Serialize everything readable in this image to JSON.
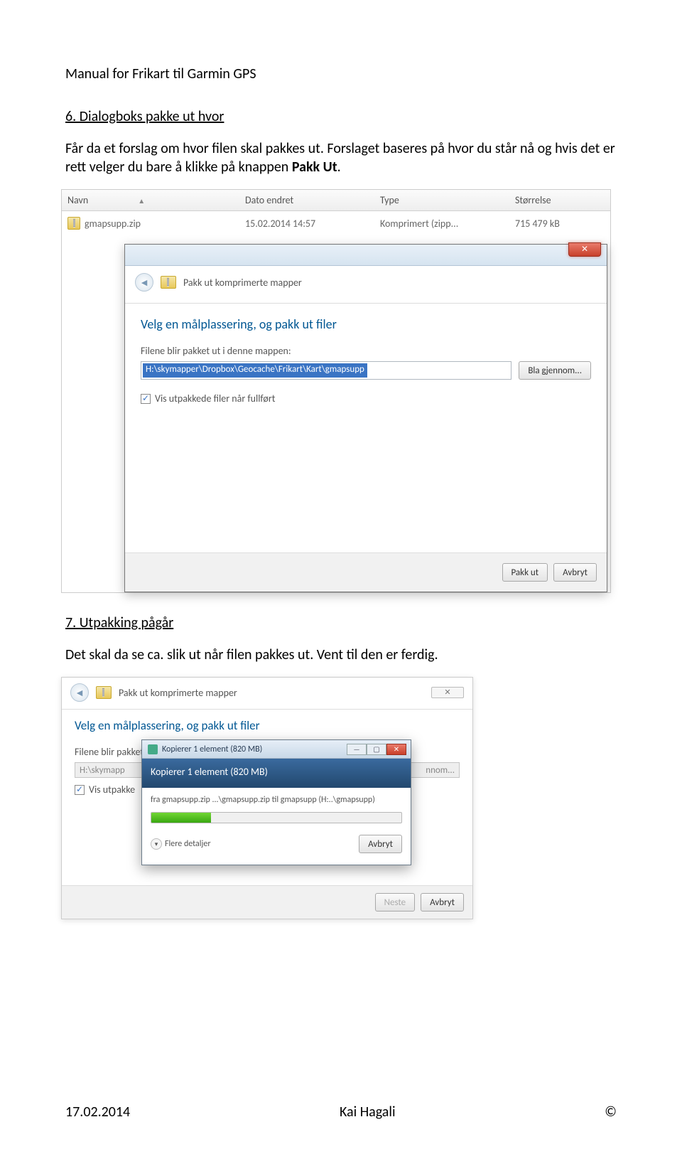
{
  "doc": {
    "title": "Manual for Frikart til Garmin GPS"
  },
  "sec6": {
    "heading": "6.   Dialogboks pakke ut hvor",
    "p1": "Får da et forslag om hvor filen skal pakkes ut. Forslaget baseres på hvor du står nå og hvis det er rett velger du bare å klikke på knappen ",
    "bold": "Pakk Ut",
    "tail": "."
  },
  "list": {
    "cols": {
      "name": "Navn",
      "date": "Dato endret",
      "type": "Type",
      "size": "Størrelse"
    },
    "row": {
      "file": "gmapsupp.zip",
      "date": "15.02.2014 14:57",
      "type": "Komprimert (zipp...",
      "size": "715 479 kB"
    }
  },
  "dlg1": {
    "title": "Pakk ut komprimerte mapper",
    "instr": "Velg en målplassering, og pakk ut filer",
    "label": "Filene blir pakket ut i denne mappen:",
    "path": "H:\\skymapper\\Dropbox\\Geocache\\Frikart\\Kart\\gmapsupp",
    "browse": "Bla gjennom...",
    "check": "Vis utpakkede filer når fullført",
    "ok": "Pakk ut",
    "cancel": "Avbryt"
  },
  "sec7": {
    "heading": "7.   Utpakking pågår",
    "p1": "Det skal da se ca. slik ut når filen pakkes ut. Vent til den er ferdig."
  },
  "dlg2": {
    "pathLeft": "H:\\skymapp",
    "pathRight": "nnom...",
    "chkLeft": "Vis utpakke",
    "next": "Neste",
    "cancel": "Avbryt"
  },
  "copy": {
    "bar": "Kopierer 1 element (820 MB)",
    "hero": "Kopierer 1 element (820 MB)",
    "from": "fra gmapsupp.zip ...\\gmapsupp.zip til gmapsupp (H:..\\gmapsupp)",
    "more": "Flere detaljer",
    "cancel": "Avbryt"
  },
  "footer": {
    "date": "17.02.2014",
    "author": "Kai Hagali",
    "mark": "©"
  }
}
